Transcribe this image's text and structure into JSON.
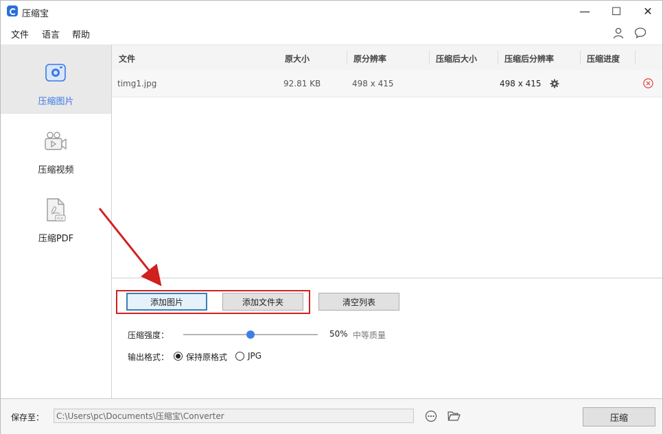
{
  "window": {
    "title": "压缩宝",
    "minimize": "—",
    "maximize": "☐",
    "close": "✕"
  },
  "menu": [
    "文件",
    "语言",
    "帮助"
  ],
  "sidebar": {
    "items": [
      {
        "label": "压缩图片",
        "icon": "image-compress-icon",
        "active": true
      },
      {
        "label": "压缩视频",
        "icon": "video-compress-icon",
        "active": false
      },
      {
        "label": "压缩PDF",
        "icon": "pdf-compress-icon",
        "active": false
      }
    ]
  },
  "table": {
    "headers": [
      "文件",
      "原大小",
      "原分辨率",
      "压缩后大小",
      "压缩后分辨率",
      "压缩进度"
    ],
    "rows": [
      {
        "file": "timg1.jpg",
        "size": "92.81 KB",
        "resolution": "498 x 415",
        "compressed_size": "",
        "compressed_resolution": "498 x 415",
        "progress": ""
      }
    ]
  },
  "actions": {
    "add_image": "添加图片",
    "add_folder": "添加文件夹",
    "clear_list": "清空列表"
  },
  "settings": {
    "strength_label": "压缩强度：",
    "strength_value": 50,
    "strength_text": "50%",
    "quality_text": "中等质量",
    "format_label": "输出格式：",
    "format_options": [
      "保持原格式",
      "JPG"
    ],
    "selected_format": "保持原格式"
  },
  "footer": {
    "save_label": "保存至：",
    "path": "C:\\Users\\pc\\Documents\\压缩宝\\Converter",
    "compress": "压缩"
  },
  "colors": {
    "accent": "#3b78e7",
    "highlight": "#d02020",
    "slider_thumb": "#3c7fe6",
    "remove_icon": "#e0413a"
  }
}
